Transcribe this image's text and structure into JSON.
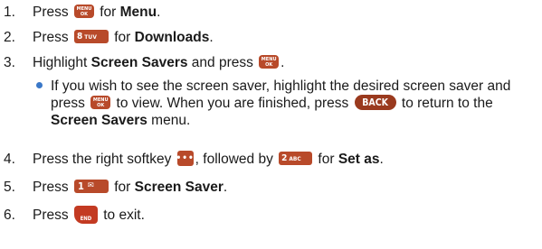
{
  "steps": [
    {
      "num": "1.",
      "pre": "Press ",
      "key": "MENU/OK",
      "mid": " for ",
      "target": "Menu",
      "post": "."
    },
    {
      "num": "2.",
      "pre": "Press ",
      "key": "8 TUV",
      "mid": " for ",
      "target": "Downloads",
      "post": "."
    },
    {
      "num": "3.",
      "pre": "Highlight ",
      "target": "Screen Savers",
      "mid": " and press ",
      "key": "MENU/OK",
      "post": "."
    },
    {
      "num": "4.",
      "pre": "Press the right softkey ",
      "key1": "softkey",
      "mid1": ", followed by ",
      "key2": "2 ABC",
      "mid2": " for ",
      "target": "Set as",
      "post": "."
    },
    {
      "num": "5.",
      "pre": "Press ",
      "key": "1 message",
      "mid": " for ",
      "target": "Screen Saver",
      "post": "."
    },
    {
      "num": "6.",
      "pre": "Press ",
      "key": "END",
      "post": " to exit."
    }
  ],
  "bullet": {
    "part1": "If you wish to see the screen saver, highlight the desired screen saver and press ",
    "part2": " to view. When you are finished, press ",
    "part3": " to return to the ",
    "target": "Screen Savers",
    "part4": " menu."
  },
  "keys": {
    "menu_top": "MENU",
    "menu_bottom": "OK",
    "eight_digit": "8",
    "eight_sub": "TUV",
    "softkey_glyph": "•••",
    "two_digit": "2",
    "two_sub": "ABC",
    "one_digit": "1",
    "one_sub": "✉",
    "end_label": "END",
    "back_label": "BACK"
  },
  "colors": {
    "key_fill": "#b84a2a",
    "bullet": "#3a78c8"
  }
}
